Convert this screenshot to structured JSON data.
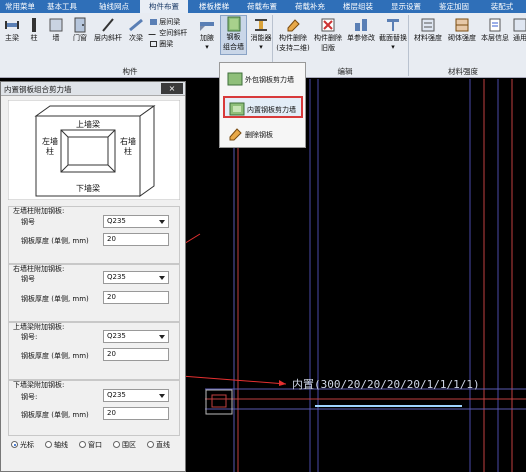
{
  "tabs": [
    {
      "label": "常用菜单"
    },
    {
      "label": "基本工具"
    },
    {
      "label": "轴线网点"
    },
    {
      "label": "构件布置",
      "active": true
    },
    {
      "label": "楼板楼梯"
    },
    {
      "label": "荷载布置"
    },
    {
      "label": "荷载补充"
    },
    {
      "label": "楼层组装"
    },
    {
      "label": "显示设置"
    },
    {
      "label": "鉴定加固"
    },
    {
      "label": "装配式"
    }
  ],
  "ribbon": {
    "main_beam": "主梁",
    "column": "柱",
    "wall": "墙",
    "door_window": "门窗",
    "inner_slant_column": "层内斜杆",
    "secondary_beam": "次梁",
    "inter_beam": "层间梁",
    "space_slant": "空间斜杆",
    "ring_beam": "圈梁",
    "haunch": "加腋",
    "steel_plate_combo": [
      "钢板",
      "组合墙"
    ],
    "energy_damper": [
      "消能器"
    ],
    "member_delete_2d": [
      "构件删除",
      "(支持二维)"
    ],
    "member_delete_old": [
      "构件删除",
      "旧版"
    ],
    "single_edit": "单参修改",
    "section_replace": "截面替换",
    "material_strength": "材料强度",
    "wall_strength": "砌体强度",
    "floor_info": "本层信息",
    "general": "通用",
    "group_member": "构件",
    "group_edit": "编辑",
    "group_material": "材料强度"
  },
  "dropdown": {
    "outer": "外包钢板剪力墙",
    "inner": "内置钢板剪力墙",
    "delete": "删除钢板"
  },
  "panel": {
    "title": "内置钢板组合剪力墙",
    "close": "×",
    "diagram": {
      "top": "上墙梁",
      "bottom": "下墙梁",
      "left": "左墙柱",
      "right": "右墙柱"
    },
    "sections": [
      {
        "heading": "左墙柱附加钢板:",
        "grade_label": "钢号",
        "grade": "Q235",
        "thickness_label": "钢板厚度 (单侧, mm)",
        "thickness": "20"
      },
      {
        "heading": "右墙柱附加钢板:",
        "grade_label": "钢号",
        "grade": "Q235",
        "thickness_label": "钢板厚度 (单侧, mm)",
        "thickness": "20"
      },
      {
        "heading": "上墙梁附加钢板:",
        "grade_label": "钢号:",
        "grade": "Q235",
        "thickness_label": "钢板厚度 (单侧, mm)",
        "thickness": "20"
      },
      {
        "heading": "下墙梁附加钢板:",
        "grade_label": "钢号:",
        "grade": "Q235",
        "thickness_label": "钢板厚度 (单侧, mm)",
        "thickness": "20"
      }
    ],
    "snap_modes": [
      {
        "label": "光标",
        "selected": true
      },
      {
        "label": "轴线",
        "selected": false
      },
      {
        "label": "窗口",
        "selected": false
      },
      {
        "label": "围区",
        "selected": false
      },
      {
        "label": "直线",
        "selected": false
      }
    ]
  },
  "canvas": {
    "annotation": "内置(300/20/20/20/20/1/1/1/1)"
  },
  "colors": {
    "tab_bar": "#2f6fb8",
    "ribbon_bg": "#e8ecf2",
    "canvas_bg": "#000000",
    "annotation_text": "#cfd6e6",
    "red_line": "#e53030",
    "blue_line": "#3a5fd0",
    "highlight_border": "#d83a3a"
  }
}
